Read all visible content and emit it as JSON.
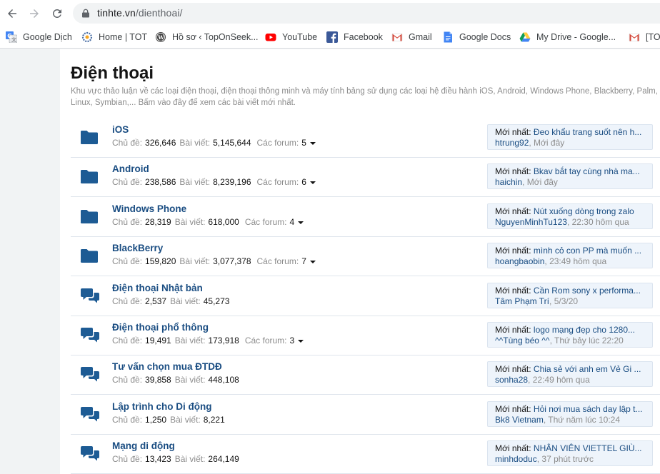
{
  "browser": {
    "url_host": "tinhte.vn",
    "url_path": "/dienthoai/",
    "bookmarks": [
      {
        "label": "Google Dịch",
        "icon": "google-translate-icon"
      },
      {
        "label": "Home | TOT",
        "icon": "settings-icon"
      },
      {
        "label": "Hồ sơ ‹ TopOnSeek...",
        "icon": "wordpress-icon"
      },
      {
        "label": "YouTube",
        "icon": "youtube-icon"
      },
      {
        "label": "Facebook",
        "icon": "facebook-icon"
      },
      {
        "label": "Gmail",
        "icon": "gmail-icon"
      },
      {
        "label": "Google Docs",
        "icon": "google-docs-icon"
      },
      {
        "label": "My Drive - Google...",
        "icon": "google-drive-icon"
      },
      {
        "label": "[TO",
        "icon": "gmail-icon"
      }
    ]
  },
  "page": {
    "title": "Điện thoại",
    "description": "Khu vực thảo luận về các loại điện thoại, điện thoại thông minh và máy tính bảng sử dụng các loại hệ điều hành iOS, Android, Windows Phone, Blackberry, Palm, Linux, Symbian,... Bấm vào đây để xem các bài viết mới nhất."
  },
  "labels": {
    "threads": "Chủ đề:",
    "posts": "Bài viết:",
    "forums": "Các forum:",
    "latest": "Mới nhất:"
  },
  "nodes": [
    {
      "title": "iOS",
      "icon": "folder-icon",
      "threads": "326,646",
      "posts": "5,145,644",
      "forums": "5",
      "latest_title": "Đeo khẩu trang suốt nên h...",
      "latest_user": "htrung92",
      "latest_time": "Mới đây"
    },
    {
      "title": "Android",
      "icon": "folder-icon",
      "threads": "238,586",
      "posts": "8,239,196",
      "forums": "6",
      "latest_title": "Bkav bắt tay cùng nhà ma...",
      "latest_user": "haichin",
      "latest_time": "Mới đây"
    },
    {
      "title": "Windows Phone",
      "icon": "folder-icon",
      "threads": "28,319",
      "posts": "618,000",
      "forums": "4",
      "latest_title": "Nút xuống dòng trong zalo",
      "latest_user": "NguyenMinhTu123",
      "latest_time": "22:30 hôm qua"
    },
    {
      "title": "BlackBerry",
      "icon": "folder-icon",
      "threads": "159,820",
      "posts": "3,077,378",
      "forums": "7",
      "latest_title": "mình cỏ con PP mà muốn ...",
      "latest_user": "hoangbaobin",
      "latest_time": "23:49 hôm qua"
    },
    {
      "title": "Điện thoại Nhật bản",
      "icon": "chat-bubbles-icon",
      "threads": "2,537",
      "posts": "45,273",
      "forums": "",
      "latest_title": "Cần Rom sony x performa...",
      "latest_user": "Tâm Phạm Trí",
      "latest_time": "5/3/20"
    },
    {
      "title": "Điện thoại phổ thông",
      "icon": "chat-bubbles-icon",
      "threads": "19,491",
      "posts": "173,918",
      "forums": "3",
      "latest_title": "logo mạng đẹp cho 1280...",
      "latest_user": "^^Tùng béo ^^",
      "latest_time": "Thứ bảy lúc 22:20"
    },
    {
      "title": "Tư vấn chọn mua ĐTDĐ",
      "icon": "chat-bubbles-icon",
      "threads": "39,858",
      "posts": "448,108",
      "forums": "",
      "latest_title": "Chia sẻ với anh em Vẻ Gi ...",
      "latest_user": "sonha28",
      "latest_time": "22:49 hôm qua"
    },
    {
      "title": "Lập trình cho Di động",
      "icon": "chat-bubbles-icon",
      "threads": "1,250",
      "posts": "8,221",
      "forums": "",
      "latest_title": "Hỏi nơi mua sách day lập t...",
      "latest_user": "Bk8 Vietnam",
      "latest_time": "Thứ năm lúc 10:24"
    },
    {
      "title": "Mạng di động",
      "icon": "chat-bubbles-icon",
      "threads": "13,423",
      "posts": "264,149",
      "forums": "",
      "latest_title": "NHÂN VIÊN VIETTEL GIÙ...",
      "latest_user": "minhdoduc",
      "latest_time": "37 phút trước"
    }
  ]
}
